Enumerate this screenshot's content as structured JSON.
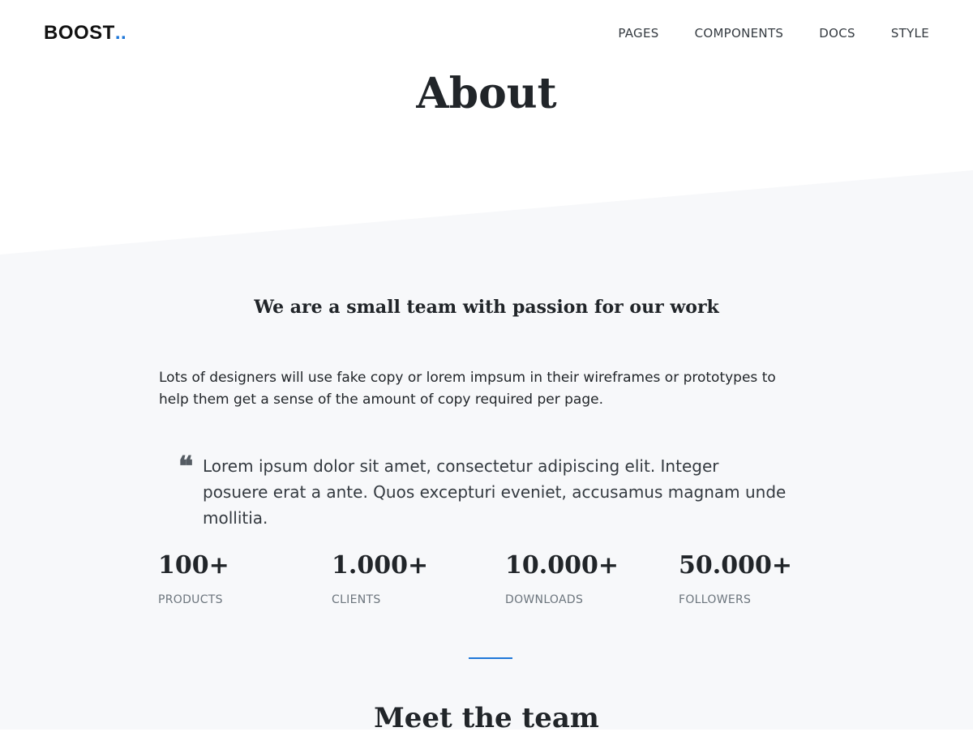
{
  "brand": {
    "name": "BOOST",
    "dots": "..",
    "accent_color": "#1e77d8"
  },
  "nav": {
    "items": [
      {
        "label": "PAGES"
      },
      {
        "label": "COMPONENTS"
      },
      {
        "label": "DOCS"
      },
      {
        "label": "STYLE"
      }
    ]
  },
  "hero": {
    "title": "About"
  },
  "about": {
    "subtitle": "We are a small team with passion for our work",
    "intro": "Lots of designers will use fake copy or lorem impsum in their wireframes or prototypes to help them get a sense of the amount of copy required per page.",
    "quote_icon": "quote-icon",
    "quote": "Lorem ipsum dolor sit amet, consectetur adipiscing elit. Integer posuere erat a ante. Quos excepturi eveniet, accusamus magnam unde mollitia."
  },
  "stats": [
    {
      "value": "100+",
      "label": "PRODUCTS"
    },
    {
      "value": "1.000+",
      "label": "CLIENTS"
    },
    {
      "value": "10.000+",
      "label": "DOWNLOADS"
    },
    {
      "value": "50.000+",
      "label": "FOLLOWERS"
    }
  ],
  "team": {
    "title": "Meet the team"
  },
  "colors": {
    "section_bg": "#f7f8fa",
    "text": "#212529",
    "muted": "#6c757d"
  }
}
